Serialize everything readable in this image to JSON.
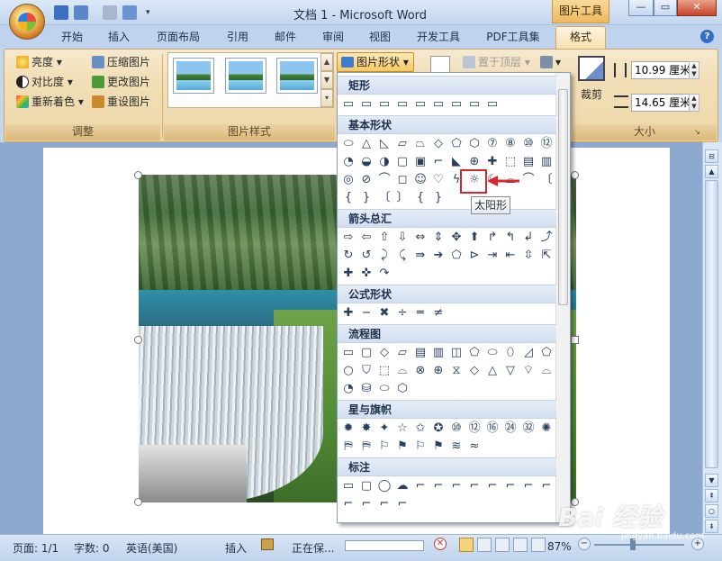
{
  "window": {
    "title": "文档 1 - Microsoft Word",
    "context_tool": "图片工具",
    "minimize": "—",
    "maximize": "▭",
    "close": "✕"
  },
  "tabs": [
    "开始",
    "插入",
    "页面布局",
    "引用",
    "邮件",
    "审阅",
    "视图",
    "开发工具",
    "PDF工具集"
  ],
  "active_tab": "格式",
  "ribbon": {
    "adjust": {
      "label": "调整",
      "brightness": "亮度",
      "contrast": "对比度",
      "recolor": "重新着色",
      "compress": "压缩图片",
      "change_picture": "更改图片",
      "reset_picture": "重设图片"
    },
    "picture_styles": {
      "label": "图片样式",
      "shapes_button": "图片形状"
    },
    "arrange": {
      "bring_front": "置于顶层"
    },
    "size": {
      "label": "大小",
      "crop": "裁剪",
      "height": "10.99 厘米",
      "width": "14.65 厘米"
    }
  },
  "shapes_menu": {
    "categories": [
      "矩形",
      "基本形状",
      "箭头总汇",
      "公式形状",
      "流程图",
      "星与旗帜",
      "标注"
    ],
    "tooltip": "太阳形",
    "highlight_color": "#d8262c"
  },
  "statusbar": {
    "page": "页面: 1/1",
    "words": "字数: 0",
    "language": "英语(美国)",
    "mode": "插入",
    "saving": "正在保...",
    "zoom": "87%"
  },
  "watermark": {
    "logo": "Bai 经验",
    "url": "jingyan.baidu.com"
  }
}
